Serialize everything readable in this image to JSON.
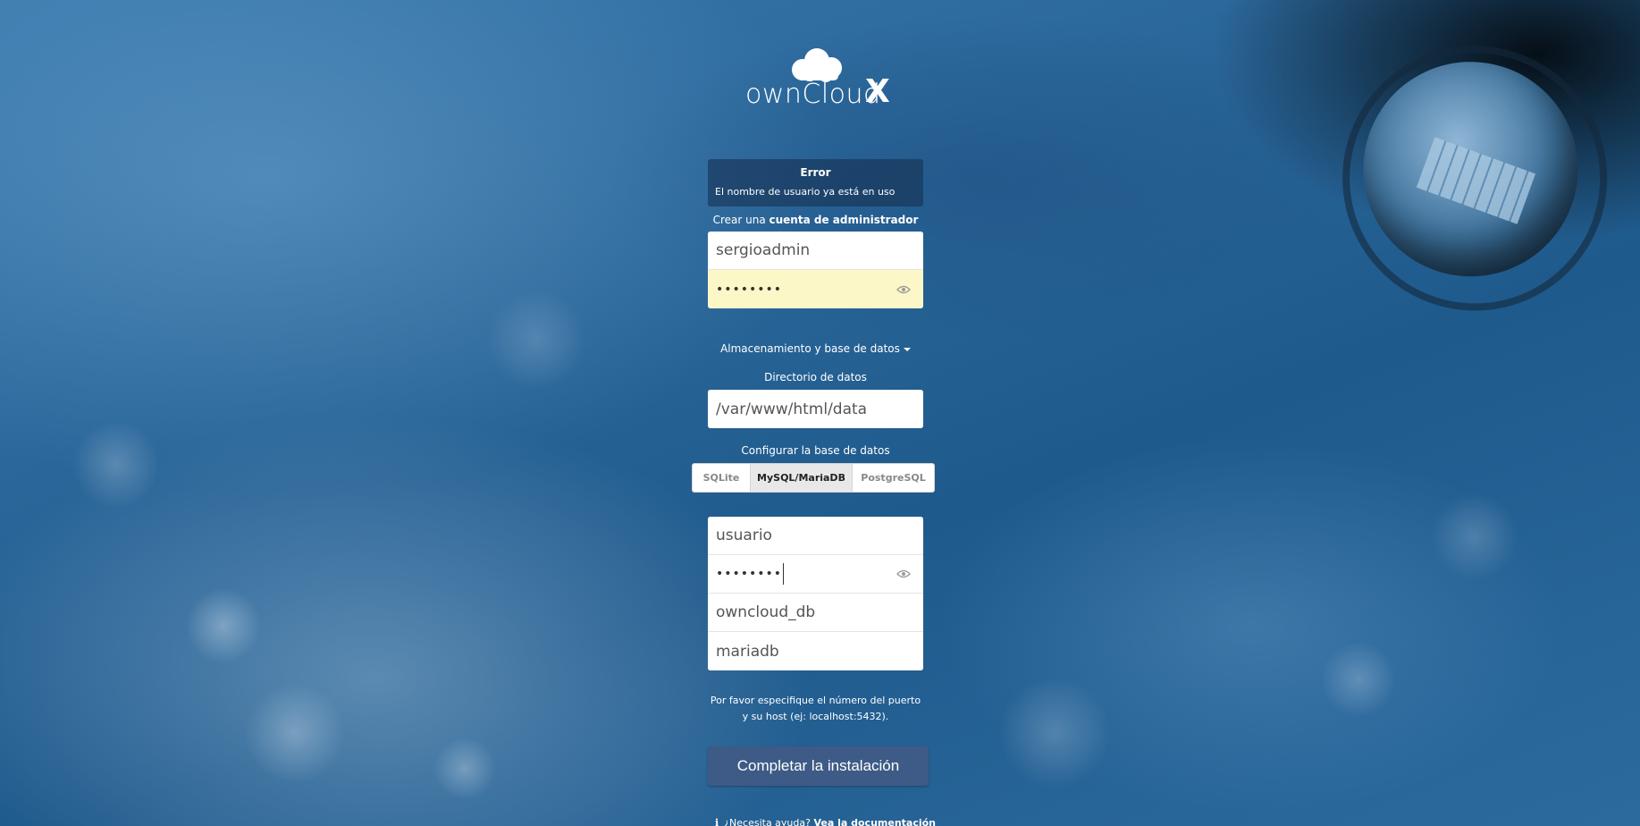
{
  "brand": {
    "name": "ownCloud",
    "suffix": "X"
  },
  "error": {
    "title": "Error",
    "message": "El nombre de usuario ya está en uso"
  },
  "admin": {
    "prefix": "Crear una ",
    "emphasis": "cuenta de administrador",
    "username_value": "sergioadmin",
    "password_mask": "••••••••"
  },
  "storage": {
    "toggle_label": "Almacenamiento y base de datos",
    "data_dir_label": "Directorio de datos",
    "data_dir_value": "/var/www/html/data"
  },
  "database": {
    "configure_label": "Configurar la base de datos",
    "tabs": [
      {
        "label": "SQLite",
        "active": false
      },
      {
        "label": "MySQL/MariaDB",
        "active": true
      },
      {
        "label": "PostgreSQL",
        "active": false
      }
    ],
    "user_value": "usuario",
    "password_mask": "••••••••",
    "name_value": "owncloud_db",
    "host_value": "mariadb",
    "hint": "Por favor especifique el número del puerto y su host (ej: localhost:5432)."
  },
  "actions": {
    "finish_label": "Completar la instalación"
  },
  "help": {
    "icon": "info-icon",
    "question": "¿Necesita ayuda?",
    "link": "Vea la documentación"
  },
  "colors": {
    "button": "#3d5b86",
    "autofill": "#fbf7c6",
    "error_bg": "#163254"
  }
}
